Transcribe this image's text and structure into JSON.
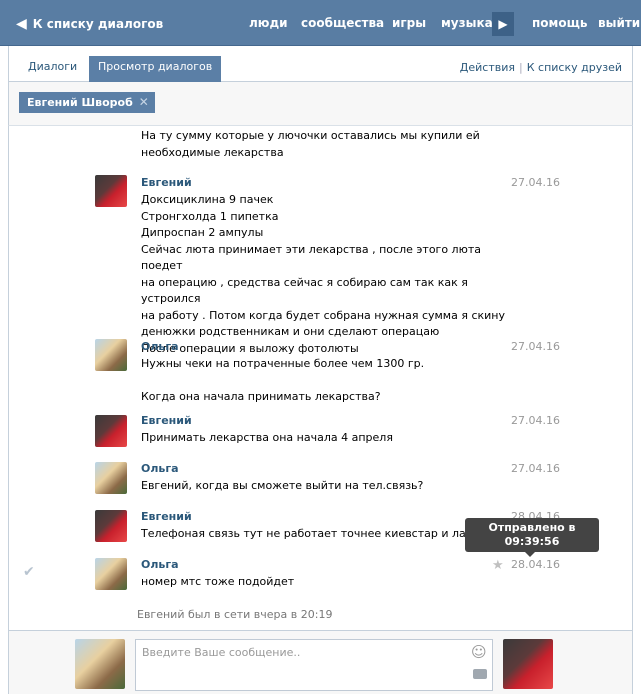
{
  "topbar": {
    "back_label": "К списку диалогов",
    "nav": [
      "люди",
      "сообщества",
      "игры",
      "музыка",
      "помощь",
      "выйти"
    ]
  },
  "tabs": {
    "dialogs": "Диалоги",
    "view": "Просмотр диалогов",
    "actions": "Действия",
    "friends": "К списку друзей"
  },
  "filter": {
    "chip_label": "Евгений Швороб"
  },
  "messages": [
    {
      "author": "",
      "date": "",
      "lines": [
        "На ту сумму которые у лючочки оставались мы купили ей",
        "необходимые лекарства"
      ]
    },
    {
      "author": "Евгений",
      "date": "27.04.16",
      "lines": [
        "Доксициклина 9 пачек",
        "Стронгхолда 1 пипетка",
        "Дипроспан 2 ампулы",
        "Сейчас люта принимает эти лекарства , после этого люта поедет",
        "на операцию , средства сейчас я собираю сам так как я устроился",
        "на работу . Потом когда будет собрана нужная сумма я скину",
        "денюжки родственникам и они сделают операцаю",
        "После операции я выложу фотолюты"
      ]
    },
    {
      "author": "Ольга",
      "date": "27.04.16",
      "lines": [
        "Нужны чеки на потраченные более чем 1300 гр.",
        "",
        "Когда она начала принимать лекарства?"
      ]
    },
    {
      "author": "Евгений",
      "date": "27.04.16",
      "lines": [
        "Принимать лекарства она начала 4 апреля"
      ]
    },
    {
      "author": "Ольга",
      "date": "27.04.16",
      "lines": [
        "Евгений, когда вы сможете выйти на тел.связь?"
      ]
    },
    {
      "author": "Евгений",
      "date": "28.04.16",
      "lines": [
        "Телефоная связь тут не работает точнее киевстар и лайф"
      ]
    },
    {
      "author": "Ольга",
      "date": "28.04.16",
      "lines": [
        "номер мтс тоже подойдет"
      ]
    }
  ],
  "tooltip": {
    "line1": "Отправлено в",
    "line2": "09:39:56"
  },
  "last_seen": "Евгений был в сети вчера в 20:19",
  "composer": {
    "placeholder": "Введите Ваше сообщение.."
  }
}
